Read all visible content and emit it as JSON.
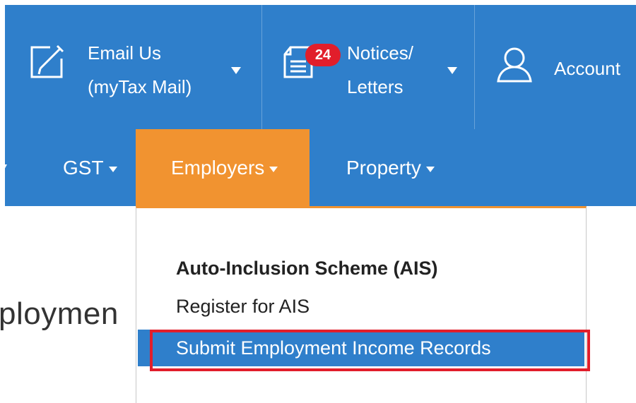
{
  "topbar": {
    "email": {
      "label_line1": "Email Us",
      "label_line2": "(myTax Mail)",
      "icon": "edit-icon"
    },
    "notices": {
      "badge_count": "24",
      "label_line1": "Notices/",
      "label_line2": "Letters",
      "icon": "document-icon"
    },
    "account": {
      "label": "Account",
      "icon": "user-icon"
    }
  },
  "nav": {
    "items": [
      {
        "label": "GST"
      },
      {
        "label": "Employers",
        "active": true
      },
      {
        "label": "Property"
      }
    ]
  },
  "background": {
    "heading_fragment": "ploymen"
  },
  "dropdown": {
    "heading": "Auto-Inclusion Scheme (AIS)",
    "items": [
      {
        "label": "Register for AIS"
      },
      {
        "label": "Submit Employment Income Records",
        "highlighted": true
      }
    ]
  },
  "colors": {
    "primary_blue": "#2f7fcb",
    "active_orange": "#f19330",
    "badge_red": "#e11e2b"
  }
}
